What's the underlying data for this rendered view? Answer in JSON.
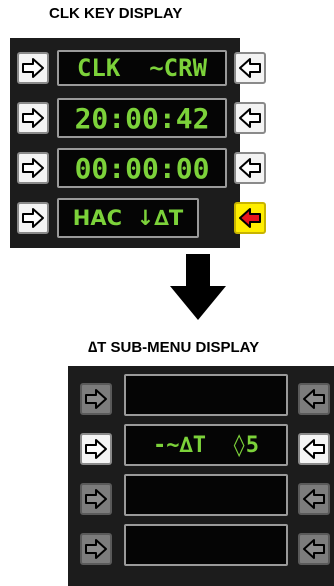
{
  "colors": {
    "panel_bg": "#1c1c1c",
    "display_text": "#7cd23a",
    "key_active": "#f4f4f4",
    "key_dim": "#7c7c7c",
    "key_highlight": "#ffee00",
    "arrow_highlight": "#e8141e"
  },
  "clk_panel": {
    "title": "CLK KEY DISPLAY",
    "rows": [
      {
        "text": "CLK  ~CRW"
      },
      {
        "text": "20:00:42"
      },
      {
        "text": "00:00:00"
      },
      {
        "text": "HAC  ↓∆T"
      }
    ]
  },
  "transition": {
    "icon": "down-arrow-icon"
  },
  "dt_panel": {
    "title": "∆T SUB-MENU DISPLAY",
    "rows": [
      {
        "text": ""
      },
      {
        "text": "-~∆T  ◊5"
      },
      {
        "text": ""
      },
      {
        "text": ""
      }
    ]
  }
}
